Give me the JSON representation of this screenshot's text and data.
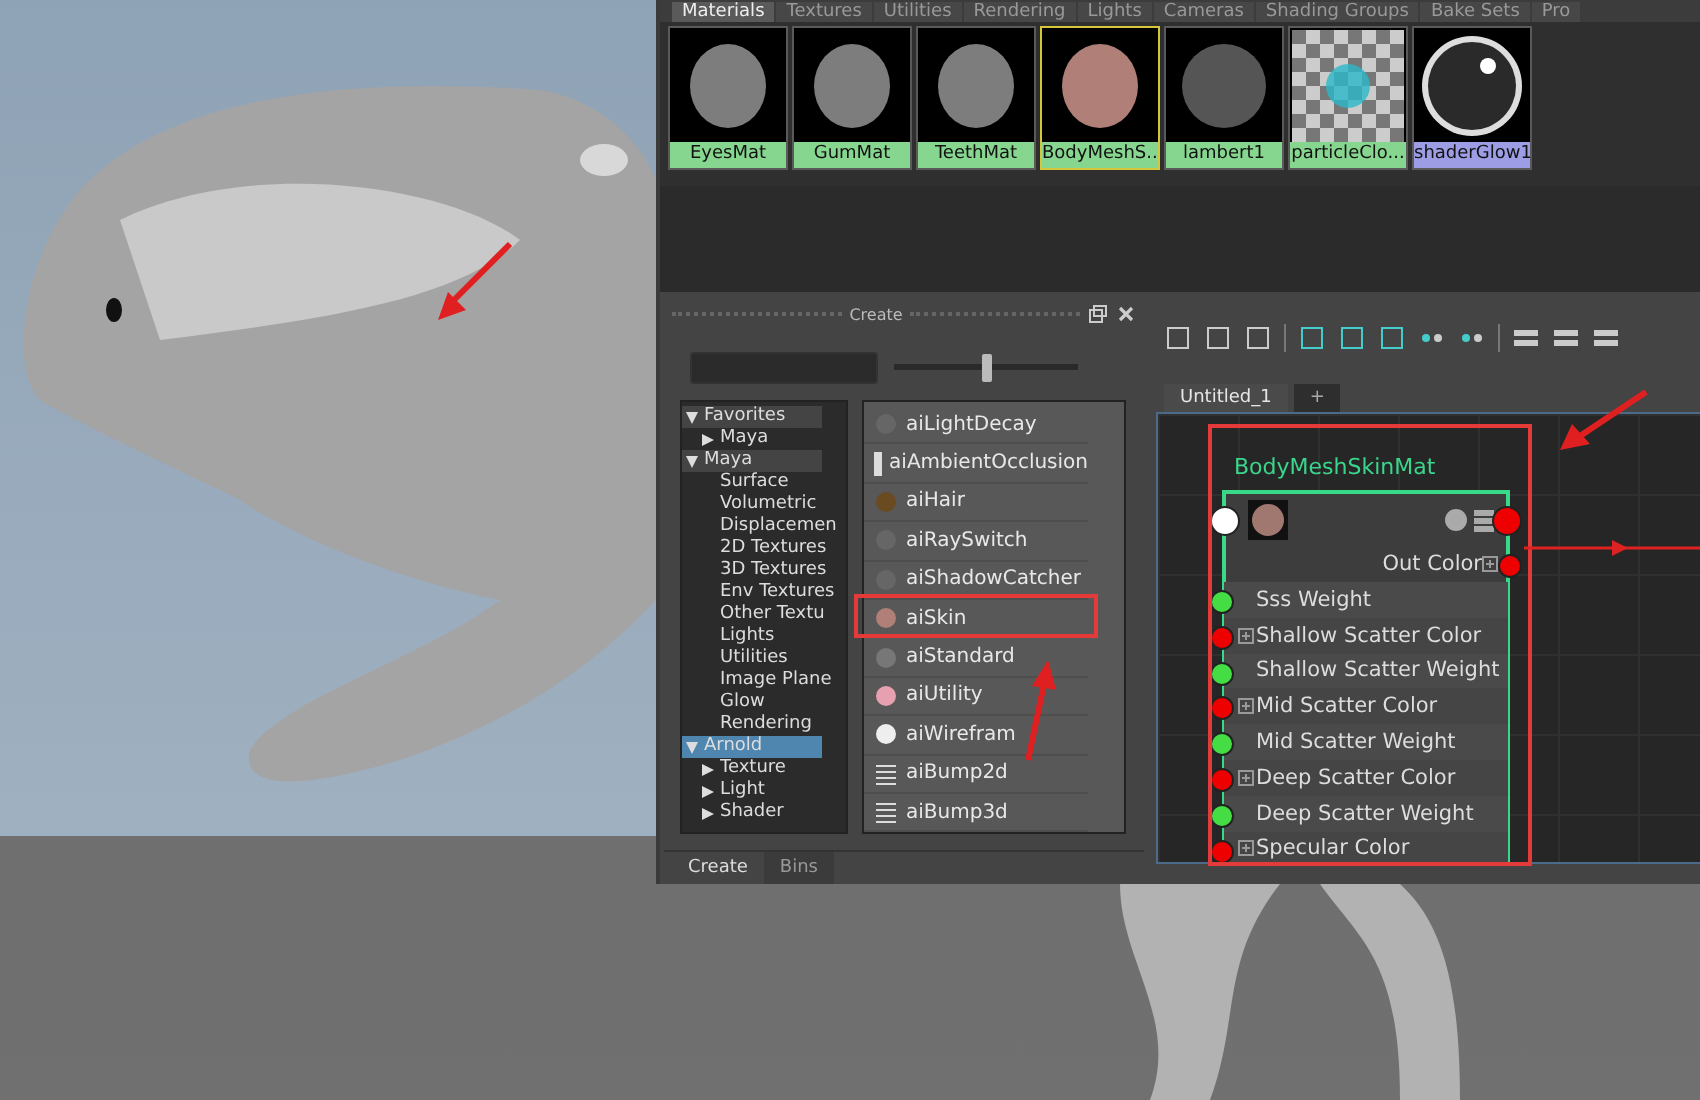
{
  "top_tabs": [
    {
      "label": "Materials",
      "selected": true
    },
    {
      "label": "Textures",
      "selected": false
    },
    {
      "label": "Utilities",
      "selected": false
    },
    {
      "label": "Rendering",
      "selected": false
    },
    {
      "label": "Lights",
      "selected": false
    },
    {
      "label": "Cameras",
      "selected": false
    },
    {
      "label": "Shading Groups",
      "selected": false
    },
    {
      "label": "Bake Sets",
      "selected": false
    },
    {
      "label": "Pro",
      "selected": false
    }
  ],
  "swatches": [
    {
      "name": "EyesMat",
      "kind": "matte",
      "color": "#86d68f",
      "selected": false
    },
    {
      "name": "GumMat",
      "kind": "matte",
      "color": "#86d68f",
      "selected": false
    },
    {
      "name": "TeethMat",
      "kind": "matte",
      "color": "#86d68f",
      "selected": false
    },
    {
      "name": "BodyMeshS...",
      "kind": "skin",
      "color": "#86d68f",
      "selected": true
    },
    {
      "name": "lambert1",
      "kind": "lambert",
      "color": "#86d68f",
      "selected": false
    },
    {
      "name": "particleClo...",
      "kind": "checker",
      "color": "#86d68f",
      "selected": false
    },
    {
      "name": "shaderGlow1",
      "kind": "glow",
      "color": "#9d9de6",
      "selected": false
    }
  ],
  "create_panel": {
    "title": "Create",
    "slider": {
      "level": 0.5
    },
    "tree": [
      {
        "label": "Favorites",
        "expanded": true,
        "selected": false,
        "children": [
          {
            "label": "Maya",
            "expanded": false,
            "selected": false
          }
        ]
      },
      {
        "label": "Maya",
        "expanded": true,
        "selected": false,
        "children": [
          {
            "label": "Surface",
            "selected": false
          },
          {
            "label": "Volumetric",
            "selected": false
          },
          {
            "label": "Displacemen",
            "selected": false
          },
          {
            "label": "2D Textures",
            "selected": false
          },
          {
            "label": "3D Textures",
            "selected": false
          },
          {
            "label": "Env Textures",
            "selected": false
          },
          {
            "label": "Other Textu",
            "selected": false
          },
          {
            "label": "Lights",
            "selected": false
          },
          {
            "label": "Utilities",
            "selected": false
          },
          {
            "label": "Image Plane",
            "selected": false
          },
          {
            "label": "Glow",
            "selected": false
          },
          {
            "label": "Rendering",
            "selected": false
          }
        ]
      },
      {
        "label": "Arnold",
        "expanded": true,
        "selected": true,
        "children": [
          {
            "label": "Texture",
            "expanded": false,
            "selected": false
          },
          {
            "label": "Light",
            "expanded": false,
            "selected": false
          },
          {
            "label": "Shader",
            "expanded": false,
            "selected": false
          }
        ]
      }
    ],
    "nodes": [
      {
        "label": "aiLightDecay",
        "kind": "sphere",
        "selected": false
      },
      {
        "label": "aiAmbientOcclusion",
        "kind": "occlusion",
        "selected": false
      },
      {
        "label": "aiHair",
        "kind": "hair",
        "selected": false
      },
      {
        "label": "aiRaySwitch",
        "kind": "sphere",
        "selected": false
      },
      {
        "label": "aiShadowCatcher",
        "kind": "sphere",
        "selected": false
      },
      {
        "label": "aiSkin",
        "kind": "skin",
        "selected": false
      },
      {
        "label": "aiStandard",
        "kind": "standard",
        "selected": false
      },
      {
        "label": "aiUtility",
        "kind": "utility",
        "selected": false
      },
      {
        "label": "aiWirefram",
        "kind": "wireframe",
        "selected": false
      },
      {
        "label": "aiBump2d",
        "kind": "bump",
        "selected": false
      },
      {
        "label": "aiBump3d",
        "kind": "bump",
        "selected": false
      }
    ],
    "bottom_tabs": [
      {
        "label": "Create",
        "selected": true
      },
      {
        "label": "Bins",
        "selected": false
      }
    ]
  },
  "node_editor": {
    "tabs": [
      {
        "label": "Untitled_1",
        "selected": true
      }
    ],
    "add_tab": "+",
    "node": {
      "title": "BodyMeshSkinMat",
      "output": "Out Color",
      "attributes": [
        {
          "label": "Sss Weight",
          "kind": "scalar"
        },
        {
          "label": "Shallow Scatter Color",
          "kind": "color"
        },
        {
          "label": "Shallow Scatter Weight",
          "kind": "scalar"
        },
        {
          "label": "Mid Scatter Color",
          "kind": "color"
        },
        {
          "label": "Mid Scatter Weight",
          "kind": "scalar"
        },
        {
          "label": "Deep Scatter Color",
          "kind": "color"
        },
        {
          "label": "Deep Scatter Weight",
          "kind": "scalar"
        },
        {
          "label": "Specular Color",
          "kind": "color"
        }
      ]
    }
  }
}
